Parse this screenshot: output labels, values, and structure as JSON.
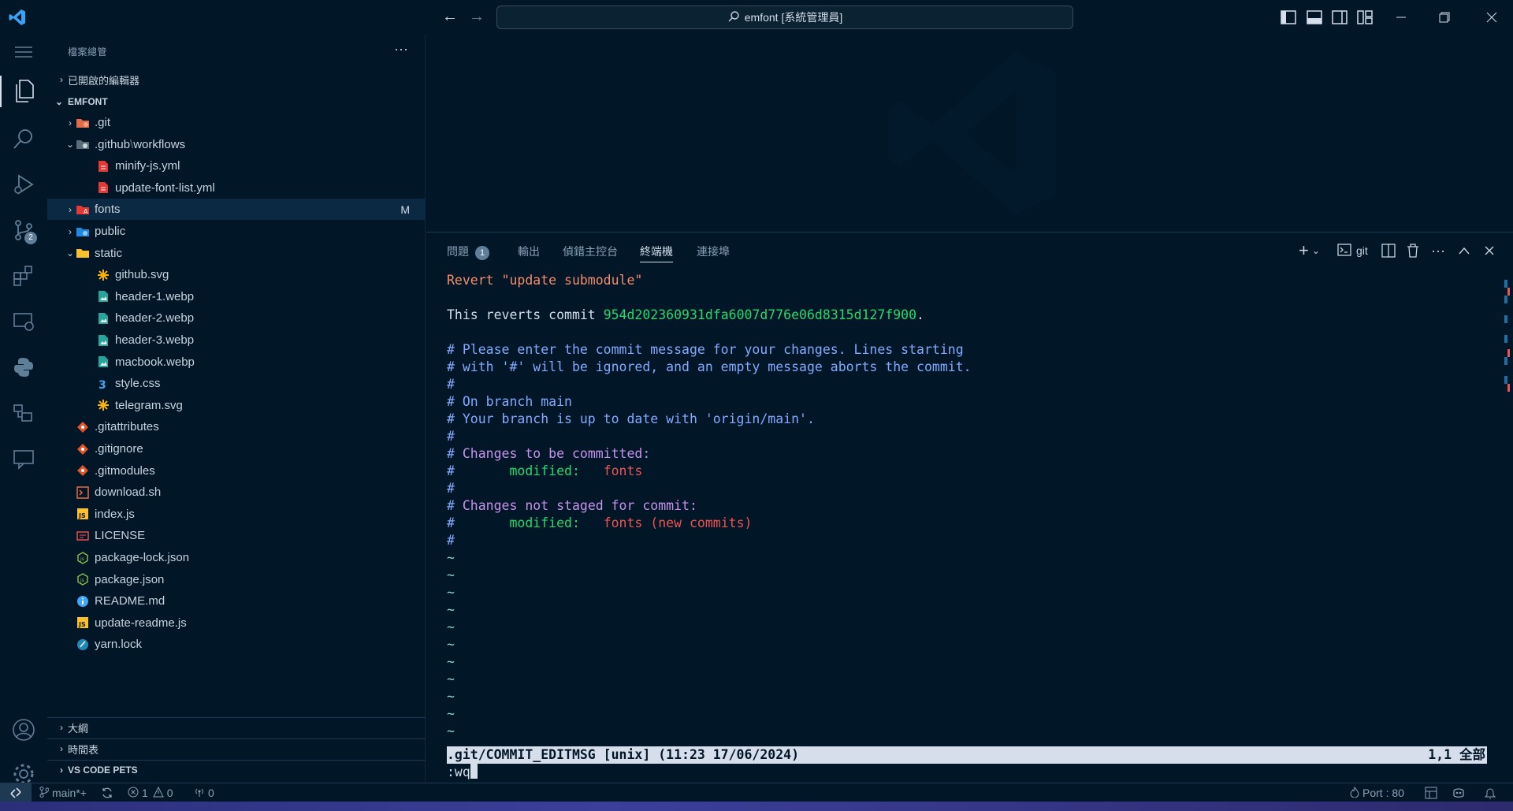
{
  "window": {
    "title": "emfont [系統管理員]"
  },
  "activity_bar": {
    "items": [
      "explorer-icon",
      "search-icon",
      "run-debug-icon",
      "source-control-icon",
      "extensions-icon",
      "remote-explorer-icon",
      "python-icon",
      "containers-icon",
      "comments-icon"
    ],
    "source_control_badge": "2",
    "bottom": [
      "account-icon",
      "manage-gear-icon"
    ]
  },
  "sidebar": {
    "title": "檔案總管",
    "open_editors": "已開啟的編輯器",
    "project": "EMFONT",
    "tree": [
      {
        "label": ".git",
        "indent": 1,
        "chev": "›",
        "icon": "folder-git-icon"
      },
      {
        "label": ".github",
        "label2": "workflows",
        "indent": 1,
        "chev": "⌄",
        "icon": "folder-github-icon"
      },
      {
        "label": "minify-js.yml",
        "indent": 2,
        "icon": "yaml-icon"
      },
      {
        "label": "update-font-list.yml",
        "indent": 2,
        "icon": "yaml-icon"
      },
      {
        "label": "fonts",
        "indent": 1,
        "chev": "›",
        "icon": "folder-font-icon",
        "badge": "M"
      },
      {
        "label": "public",
        "indent": 1,
        "chev": "›",
        "icon": "folder-public-icon"
      },
      {
        "label": "static",
        "indent": 1,
        "chev": "⌄",
        "icon": "folder-open-icon"
      },
      {
        "label": "github.svg",
        "indent": 2,
        "icon": "svg-icon"
      },
      {
        "label": "header-1.webp",
        "indent": 2,
        "icon": "image-icon"
      },
      {
        "label": "header-2.webp",
        "indent": 2,
        "icon": "image-icon"
      },
      {
        "label": "header-3.webp",
        "indent": 2,
        "icon": "image-icon"
      },
      {
        "label": "macbook.webp",
        "indent": 2,
        "icon": "image-icon"
      },
      {
        "label": "style.css",
        "indent": 2,
        "icon": "css-icon"
      },
      {
        "label": "telegram.svg",
        "indent": 2,
        "icon": "svg-icon"
      },
      {
        "label": ".gitattributes",
        "indent": 1,
        "icon": "git-file-icon"
      },
      {
        "label": ".gitignore",
        "indent": 1,
        "icon": "git-file-icon"
      },
      {
        "label": ".gitmodules",
        "indent": 1,
        "icon": "git-file-icon"
      },
      {
        "label": "download.sh",
        "indent": 1,
        "icon": "shell-icon"
      },
      {
        "label": "index.js",
        "indent": 1,
        "icon": "js-icon"
      },
      {
        "label": "LICENSE",
        "indent": 1,
        "icon": "license-icon"
      },
      {
        "label": "package-lock.json",
        "indent": 1,
        "icon": "node-json-icon"
      },
      {
        "label": "package.json",
        "indent": 1,
        "icon": "node-json-icon"
      },
      {
        "label": "README.md",
        "indent": 1,
        "icon": "info-icon"
      },
      {
        "label": "update-readme.js",
        "indent": 1,
        "icon": "js-icon"
      },
      {
        "label": "yarn.lock",
        "indent": 1,
        "icon": "yarn-icon"
      }
    ],
    "bottom_sections": [
      "大綱",
      "時間表",
      "VS CODE PETS"
    ]
  },
  "panel": {
    "tabs": [
      {
        "label": "問題",
        "badge": "1"
      },
      {
        "label": "輸出"
      },
      {
        "label": "偵錯主控台"
      },
      {
        "label": "終端機",
        "active": true
      },
      {
        "label": "連接埠"
      }
    ],
    "terminal_name": "git"
  },
  "terminal": {
    "line_revert": "Revert \"update submodule\"",
    "line_reverts_prefix": "This reverts commit ",
    "line_reverts_hash": "954d202360931dfa6007d776e06d8315d127f900",
    "line_reverts_suffix": ".",
    "c1": "# Please enter the commit message for your changes. Lines starting",
    "c2": "# with '#' will be ignored, and an empty message aborts the commit.",
    "c3": "#",
    "c4": "# On branch main",
    "c5": "# Your branch is up to date with 'origin/main'.",
    "c6": "#",
    "c7_hash": "#",
    "c7": " Changes to be committed:",
    "c8_hash": "#",
    "c8_mod": "       modified:   ",
    "c8_file": "fonts",
    "c9": "#",
    "c10_hash": "#",
    "c10": " Changes not staged for commit:",
    "c11_hash": "#",
    "c11_mod": "       modified:   ",
    "c11_file": "fonts (new commits)",
    "c12": "#",
    "tilde": "~",
    "status_left": ".git/COMMIT_EDITMSG [unix] (11:23 17/06/2024)",
    "status_right": "1,1 全部",
    "command": ":wq"
  },
  "statusbar": {
    "branch": "main*+",
    "errors": "1",
    "warnings": "0",
    "ports_info": "0",
    "port": "Port : 80"
  }
}
